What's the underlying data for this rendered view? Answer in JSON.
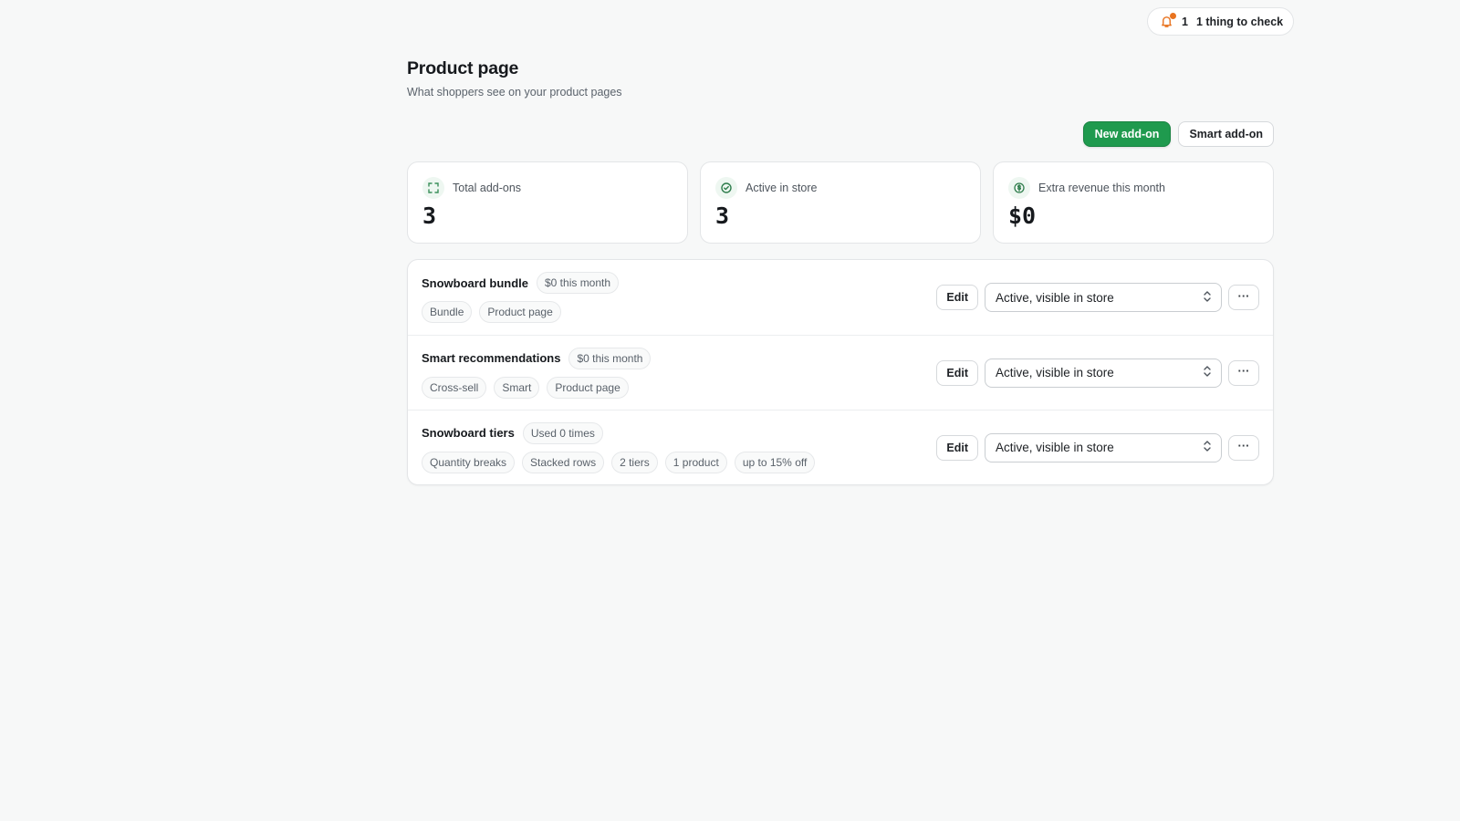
{
  "notification": {
    "icon": "bell-icon",
    "count": "1",
    "label": "1 thing to check",
    "dot_color": "#e8731f"
  },
  "page": {
    "title": "Product page",
    "subtitle": "What shoppers see on your product pages"
  },
  "actions": {
    "primary_label": "New add-on",
    "secondary_label": "Smart add-on",
    "accent_color": "#1f9a4e"
  },
  "stats": [
    {
      "icon": "expand-icon",
      "label": "Total add-ons",
      "value": "3"
    },
    {
      "icon": "check-circle-icon",
      "label": "Active in store",
      "value": "3"
    },
    {
      "icon": "dollar-circle-icon",
      "label": "Extra revenue this month",
      "value": "$0"
    }
  ],
  "addons": [
    {
      "name": "Snowboard bundle",
      "badge": "$0 this month",
      "tags": [
        "Bundle",
        "Product page"
      ],
      "edit_label": "Edit",
      "status": "Active, visible in store",
      "more_label": "···"
    },
    {
      "name": "Smart recommendations",
      "badge": "$0 this month",
      "tags": [
        "Cross-sell",
        "Smart",
        "Product page"
      ],
      "edit_label": "Edit",
      "status": "Active, visible in store",
      "more_label": "···"
    },
    {
      "name": "Snowboard tiers",
      "badge": "Used 0 times",
      "tags": [
        "Quantity breaks",
        "Stacked rows",
        "2 tiers",
        "1 product",
        "up to 15% off"
      ],
      "edit_label": "Edit",
      "status": "Active, visible in store",
      "more_label": "···"
    }
  ]
}
